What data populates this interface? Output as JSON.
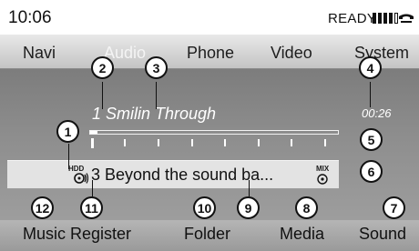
{
  "status": {
    "clock": "10:06",
    "ready": "READY",
    "signal_icon": "signal-strength-icon",
    "phone_icon": "phone-handset-icon"
  },
  "menu": {
    "items": [
      "Navi",
      "Audio",
      "Phone",
      "Video",
      "System"
    ]
  },
  "track": {
    "title": "1 Smilin Through",
    "time": "00:26",
    "progress_fraction": 0.03
  },
  "current": {
    "hdd_label": "HDD",
    "disc_icon": "hdd-disc-icon",
    "name": "3 Beyond the sound ba...",
    "mix_label": "MIX",
    "mix_icon": "mix-disc-icon"
  },
  "bottom": {
    "items": [
      "Music Register",
      "Folder",
      "Media",
      "Sound"
    ]
  },
  "callouts": [
    "1",
    "2",
    "3",
    "4",
    "5",
    "6",
    "7",
    "8",
    "9",
    "10",
    "11",
    "12"
  ]
}
